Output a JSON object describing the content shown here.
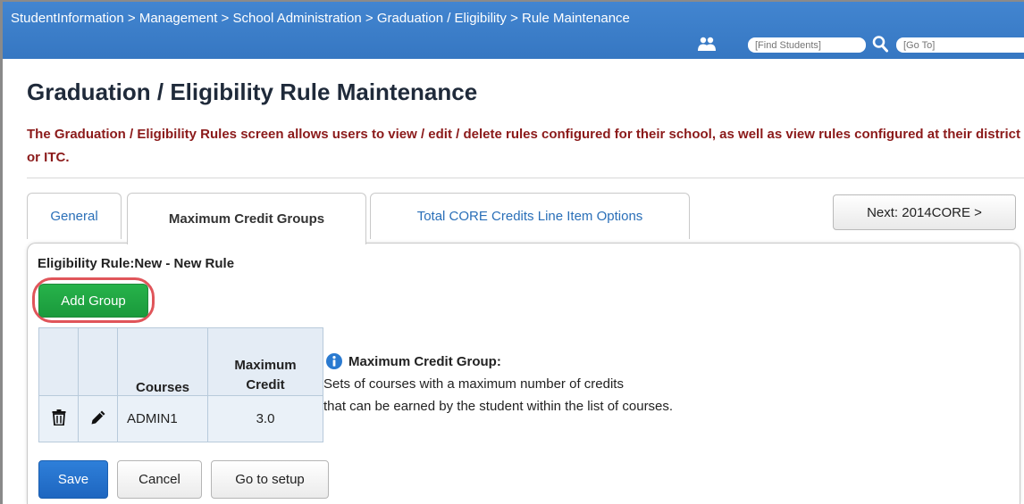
{
  "breadcrumb": "StudentInformation > Management > School Administration > Graduation / Eligibility > Rule Maintenance",
  "header": {
    "people_icon": "people-icon",
    "find_students_placeholder": "[Find Students]",
    "search_icon": "search-icon",
    "goto_placeholder": "[Go To]",
    "bar_color": "#3b7dc8"
  },
  "page_title": "Graduation / Eligibility Rule Maintenance",
  "description": "The Graduation / Eligibility Rules screen allows users to view / edit / delete rules configured for their school, as well as view rules configured at their district or ITC.",
  "tabs": [
    {
      "label": "General",
      "active": false
    },
    {
      "label": "Maximum Credit Groups",
      "active": true
    },
    {
      "label": "Total CORE Credits Line Item Options",
      "active": false
    }
  ],
  "next_button": "Next: 2014CORE >",
  "rule": {
    "prefix": "Eligibility Rule:",
    "value": "New - New Rule"
  },
  "add_group_button": "Add Group",
  "table": {
    "headers": {
      "courses": "Courses",
      "max_line1": "Maximum",
      "max_line2": "Credit"
    },
    "rows": [
      {
        "courses": "ADMIN1",
        "max_credit": "3.0",
        "delete_icon": "trash-icon",
        "edit_icon": "pencil-icon"
      }
    ]
  },
  "info": {
    "icon": "info-icon",
    "title": "Maximum Credit Group:",
    "line1": "Sets of courses with a maximum number of credits",
    "line2": "that can be earned by the student within the list of courses."
  },
  "buttons": {
    "save": "Save",
    "cancel": "Cancel",
    "go_to_setup": "Go to setup"
  },
  "colors": {
    "accent": "#3b7dc8",
    "description_text": "#8b1a1a",
    "add_group": "#1fa643",
    "highlight": "#e0555a",
    "save": "#2674d0"
  }
}
